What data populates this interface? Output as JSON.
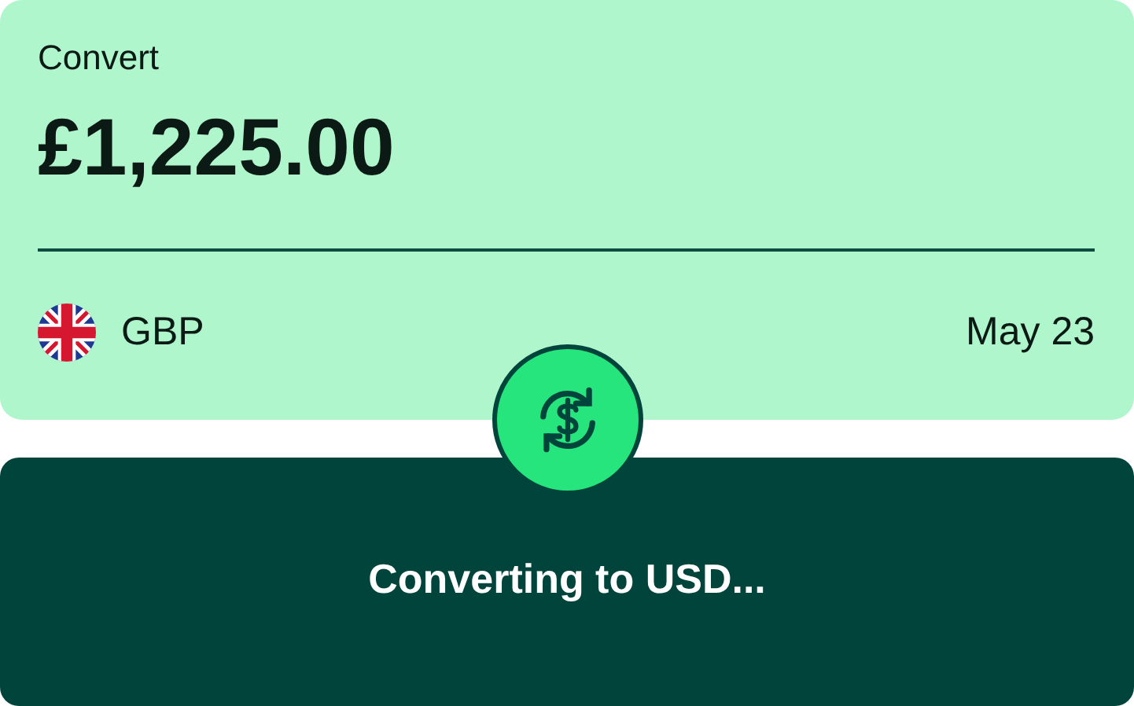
{
  "convert_card": {
    "label": "Convert",
    "amount": "£1,225.00",
    "currency": "GBP",
    "date": "May 23"
  },
  "status_panel": {
    "message": "Converting to USD..."
  }
}
